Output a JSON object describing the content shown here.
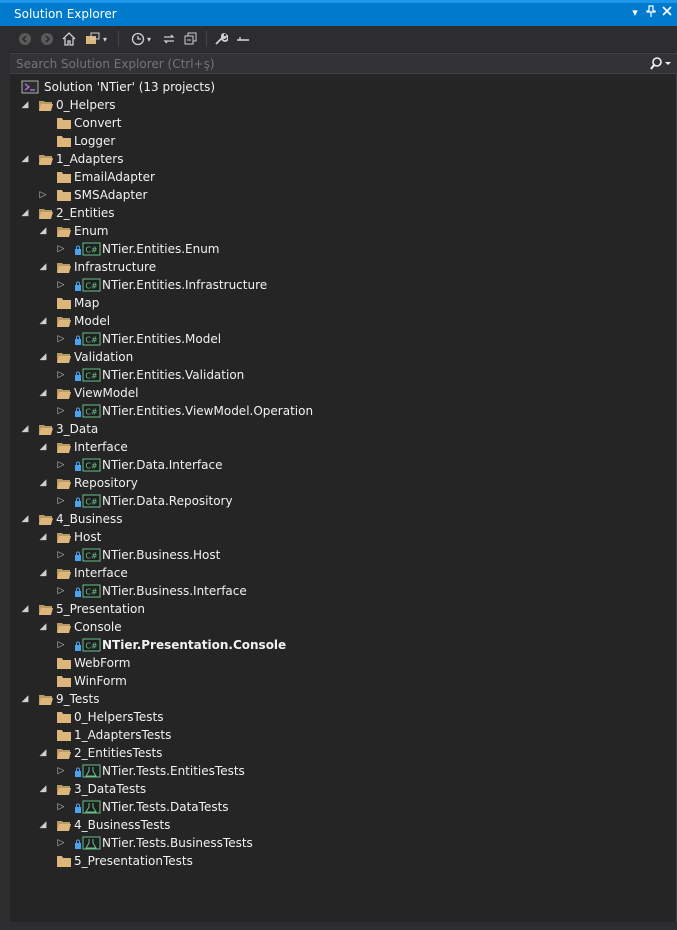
{
  "window": {
    "title": "Solution Explorer"
  },
  "search": {
    "placeholder": "Search Solution Explorer (Ctrl+ş)"
  },
  "tree": [
    {
      "label": "Solution 'NTier' (13 projects)",
      "level": 0,
      "expand": "none",
      "kind": "solution",
      "bold": false
    },
    {
      "label": "0_Helpers",
      "level": 1,
      "expand": "open",
      "kind": "folder-open",
      "bold": false
    },
    {
      "label": "Convert",
      "level": 2,
      "expand": "none",
      "kind": "folder",
      "bold": false
    },
    {
      "label": "Logger",
      "level": 2,
      "expand": "none",
      "kind": "folder",
      "bold": false
    },
    {
      "label": "1_Adapters",
      "level": 1,
      "expand": "open",
      "kind": "folder-open",
      "bold": false
    },
    {
      "label": "EmailAdapter",
      "level": 2,
      "expand": "none",
      "kind": "folder",
      "bold": false
    },
    {
      "label": "SMSAdapter",
      "level": 2,
      "expand": "closed",
      "kind": "folder",
      "bold": false
    },
    {
      "label": "2_Entities",
      "level": 1,
      "expand": "open",
      "kind": "folder-open",
      "bold": false
    },
    {
      "label": "Enum",
      "level": 2,
      "expand": "open",
      "kind": "folder-open",
      "bold": false
    },
    {
      "label": "NTier.Entities.Enum",
      "level": 3,
      "expand": "closed",
      "kind": "csproj",
      "bold": false
    },
    {
      "label": "Infrastructure",
      "level": 2,
      "expand": "open",
      "kind": "folder-open",
      "bold": false
    },
    {
      "label": "NTier.Entities.Infrastructure",
      "level": 3,
      "expand": "closed",
      "kind": "csproj",
      "bold": false
    },
    {
      "label": "Map",
      "level": 2,
      "expand": "none",
      "kind": "folder",
      "bold": false
    },
    {
      "label": "Model",
      "level": 2,
      "expand": "open",
      "kind": "folder-open",
      "bold": false
    },
    {
      "label": "NTier.Entities.Model",
      "level": 3,
      "expand": "closed",
      "kind": "csproj",
      "bold": false
    },
    {
      "label": "Validation",
      "level": 2,
      "expand": "open",
      "kind": "folder-open",
      "bold": false
    },
    {
      "label": "NTier.Entities.Validation",
      "level": 3,
      "expand": "closed",
      "kind": "csproj",
      "bold": false
    },
    {
      "label": "ViewModel",
      "level": 2,
      "expand": "open",
      "kind": "folder-open",
      "bold": false
    },
    {
      "label": "NTier.Entities.ViewModel.Operation",
      "level": 3,
      "expand": "closed",
      "kind": "csproj",
      "bold": false
    },
    {
      "label": "3_Data",
      "level": 1,
      "expand": "open",
      "kind": "folder-open",
      "bold": false
    },
    {
      "label": "Interface",
      "level": 2,
      "expand": "open",
      "kind": "folder-open",
      "bold": false
    },
    {
      "label": "NTier.Data.Interface",
      "level": 3,
      "expand": "closed",
      "kind": "csproj",
      "bold": false
    },
    {
      "label": "Repository",
      "level": 2,
      "expand": "open",
      "kind": "folder-open",
      "bold": false
    },
    {
      "label": "NTier.Data.Repository",
      "level": 3,
      "expand": "closed",
      "kind": "csproj",
      "bold": false
    },
    {
      "label": "4_Business",
      "level": 1,
      "expand": "open",
      "kind": "folder-open",
      "bold": false
    },
    {
      "label": "Host",
      "level": 2,
      "expand": "open",
      "kind": "folder-open",
      "bold": false
    },
    {
      "label": "NTier.Business.Host",
      "level": 3,
      "expand": "closed",
      "kind": "csproj",
      "bold": false
    },
    {
      "label": "Interface",
      "level": 2,
      "expand": "open",
      "kind": "folder-open",
      "bold": false
    },
    {
      "label": "NTier.Business.Interface",
      "level": 3,
      "expand": "closed",
      "kind": "csproj",
      "bold": false
    },
    {
      "label": "5_Presentation",
      "level": 1,
      "expand": "open",
      "kind": "folder-open",
      "bold": false
    },
    {
      "label": "Console",
      "level": 2,
      "expand": "open",
      "kind": "folder-open",
      "bold": false
    },
    {
      "label": "NTier.Presentation.Console",
      "level": 3,
      "expand": "closed",
      "kind": "csproj",
      "bold": true
    },
    {
      "label": "WebForm",
      "level": 2,
      "expand": "none",
      "kind": "folder",
      "bold": false
    },
    {
      "label": "WinForm",
      "level": 2,
      "expand": "none",
      "kind": "folder",
      "bold": false
    },
    {
      "label": "9_Tests",
      "level": 1,
      "expand": "open",
      "kind": "folder-open",
      "bold": false
    },
    {
      "label": "0_HelpersTests",
      "level": 2,
      "expand": "none",
      "kind": "folder",
      "bold": false
    },
    {
      "label": "1_AdaptersTests",
      "level": 2,
      "expand": "none",
      "kind": "folder",
      "bold": false
    },
    {
      "label": "2_EntitiesTests",
      "level": 2,
      "expand": "open",
      "kind": "folder-open",
      "bold": false
    },
    {
      "label": "NTier.Tests.EntitiesTests",
      "level": 3,
      "expand": "closed",
      "kind": "testproj",
      "bold": false
    },
    {
      "label": "3_DataTests",
      "level": 2,
      "expand": "open",
      "kind": "folder-open",
      "bold": false
    },
    {
      "label": "NTier.Tests.DataTests",
      "level": 3,
      "expand": "closed",
      "kind": "testproj",
      "bold": false
    },
    {
      "label": "4_BusinessTests",
      "level": 2,
      "expand": "open",
      "kind": "folder-open",
      "bold": false
    },
    {
      "label": "NTier.Tests.BusinessTests",
      "level": 3,
      "expand": "closed",
      "kind": "testproj",
      "bold": false
    },
    {
      "label": "5_PresentationTests",
      "level": 2,
      "expand": "none",
      "kind": "folder",
      "bold": false
    }
  ],
  "colors": {
    "accent": "#007acc",
    "folder": "#dcb67a",
    "background": "#252526",
    "csharp": "#68c08a",
    "lock": "#4aa3f0"
  }
}
